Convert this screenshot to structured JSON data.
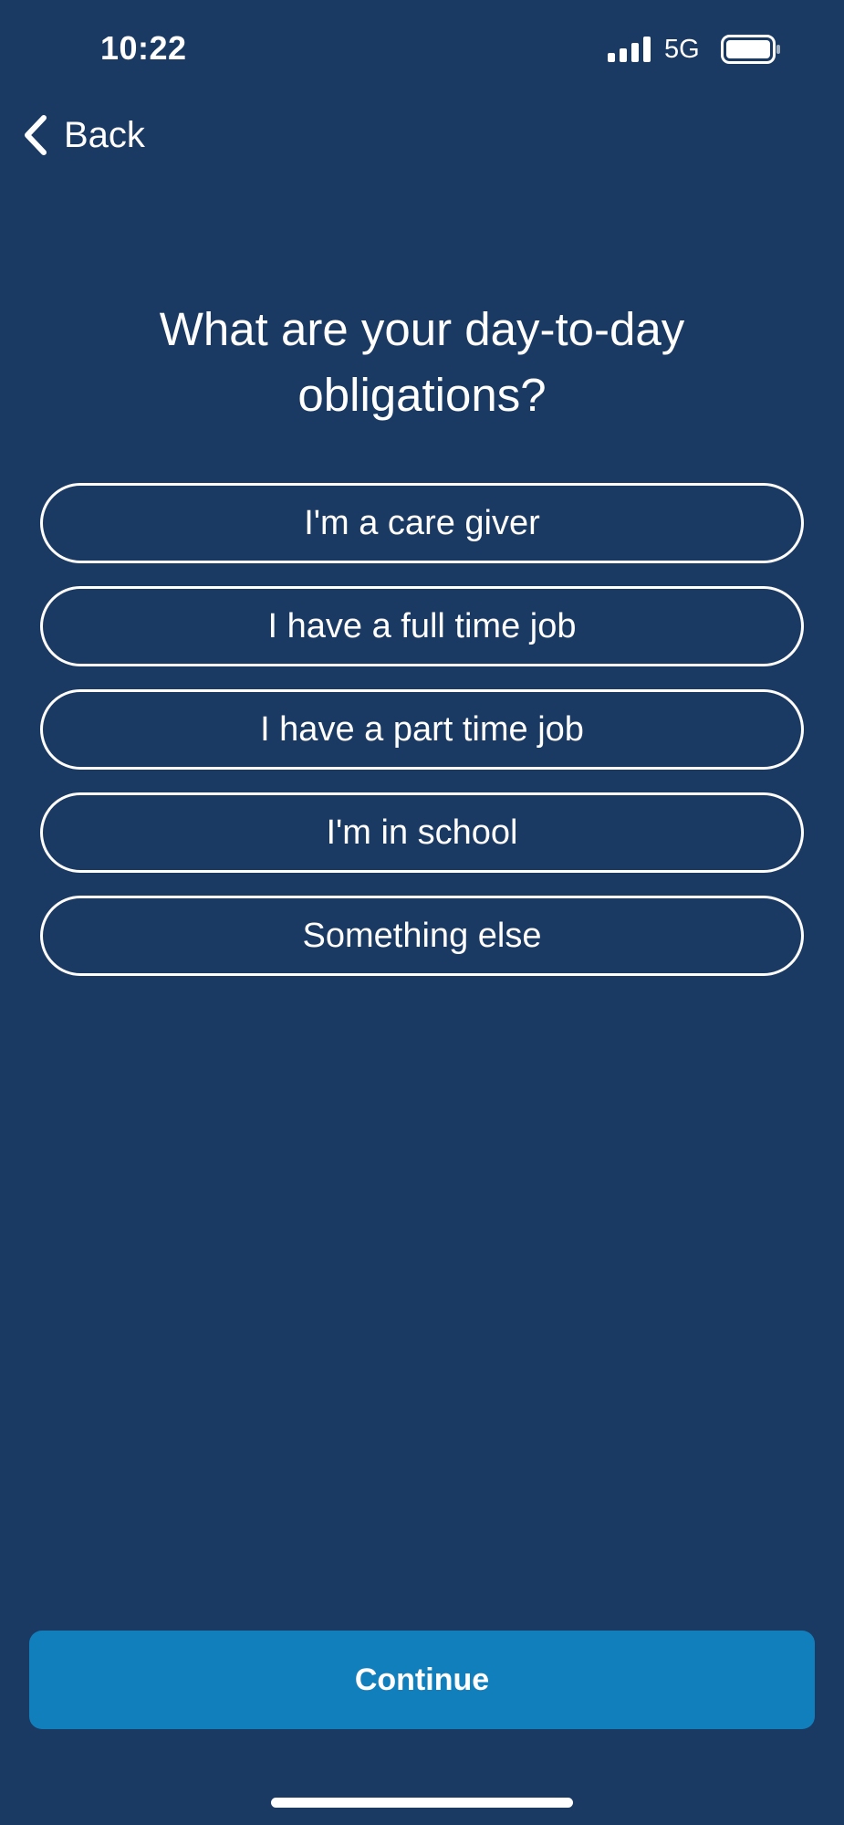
{
  "status_bar": {
    "time": "10:22",
    "network": "5G",
    "signal_icon": "signal-bars-icon",
    "battery_icon": "battery-icon"
  },
  "nav": {
    "back_label": "Back",
    "back_icon": "chevron-left-icon"
  },
  "question": {
    "title": "What are your day-to-day obligations?"
  },
  "options": [
    {
      "label": "I'm a care giver"
    },
    {
      "label": "I have a full time job"
    },
    {
      "label": "I have a part time job"
    },
    {
      "label": "I'm in school"
    },
    {
      "label": "Something else"
    }
  ],
  "continue_label": "Continue",
  "colors": {
    "background": "#1a3a63",
    "primary_button": "#127fbd",
    "text": "#ffffff"
  }
}
